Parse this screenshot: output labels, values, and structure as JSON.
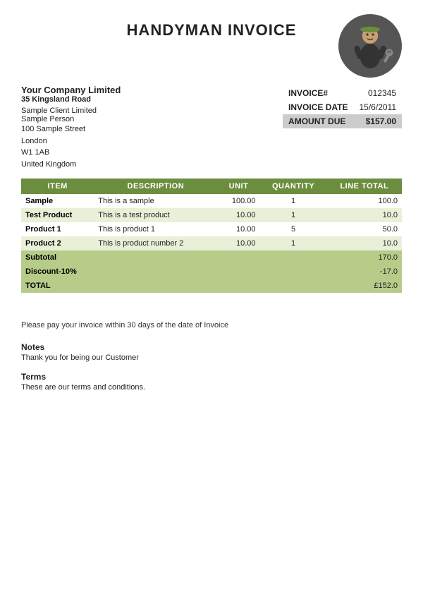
{
  "header": {
    "title": "HANDYMAN INVOICE"
  },
  "company": {
    "name": "Your Company Limited",
    "street": "35 Kingsland Road",
    "city": ""
  },
  "client": {
    "name": "Sample Client Limited",
    "contact": "Sample Person",
    "address1": "100 Sample Street",
    "city": "London",
    "postcode": "W1 1AB",
    "country": "United Kingdom"
  },
  "invoice": {
    "number_label": "INVOICE#",
    "number_value": "012345",
    "date_label": "INVOICE DATE",
    "date_value": "15/6/2011",
    "amount_label": "AMOUNT DUE",
    "amount_value": "$157.00"
  },
  "table": {
    "headers": [
      "ITEM",
      "DESCRIPTION",
      "UNIT",
      "QUANTITY",
      "LINE TOTAL"
    ],
    "rows": [
      {
        "item": "Sample",
        "description": "This is a sample",
        "unit": "100.00",
        "quantity": "1",
        "total": "100.0"
      },
      {
        "item": "Test Product",
        "description": "This is a test product",
        "unit": "10.00",
        "quantity": "1",
        "total": "10.0"
      },
      {
        "item": "Product 1",
        "description": "This is product 1",
        "unit": "10.00",
        "quantity": "5",
        "total": "50.0"
      },
      {
        "item": "Product 2",
        "description": "This is product number 2",
        "unit": "10.00",
        "quantity": "1",
        "total": "10.0"
      }
    ],
    "subtotal_label": "Subtotal",
    "subtotal_value": "170.0",
    "discount_label": "Discount-10%",
    "discount_value": "-17.0",
    "total_label": "TOTAL",
    "total_value": "£152.0"
  },
  "footer": {
    "payment_note": "Please pay your invoice within 30 days of the date of Invoice",
    "notes_label": "Notes",
    "notes_text": "Thank you for being our Customer",
    "terms_label": "Terms",
    "terms_text": "These are our terms and conditions."
  }
}
